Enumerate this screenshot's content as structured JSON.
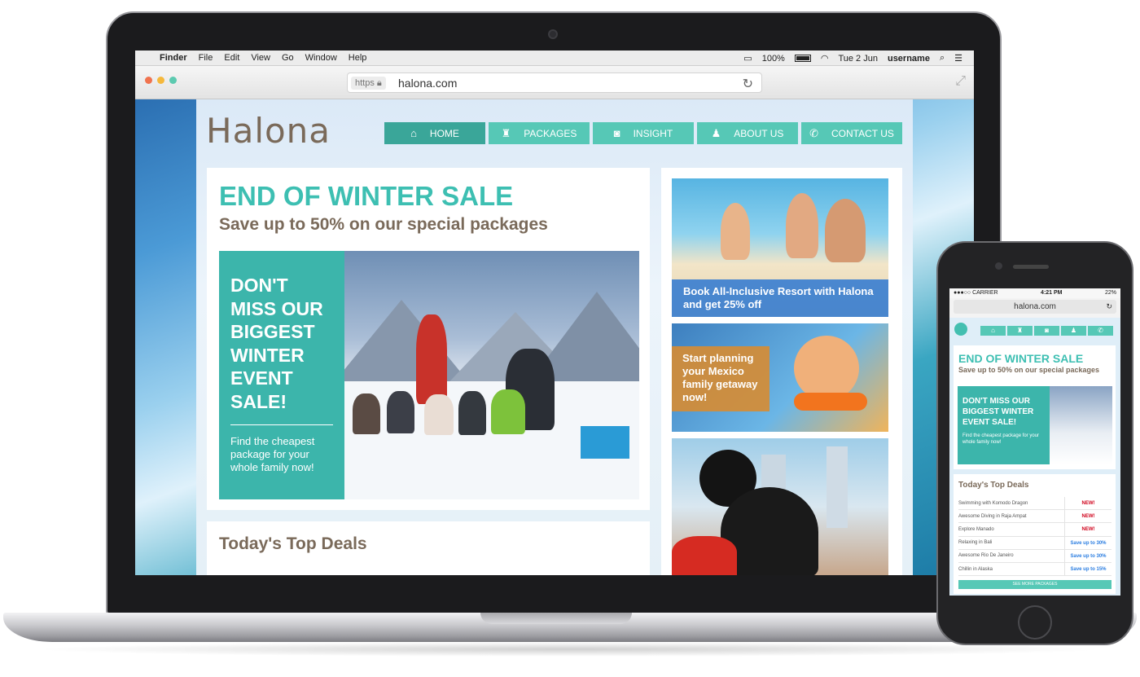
{
  "menubar": {
    "apple": "",
    "app": "Finder",
    "items": [
      "File",
      "Edit",
      "View",
      "Go",
      "Window",
      "Help"
    ],
    "battery": "100%",
    "date": "Tue 2 Jun",
    "user": "username"
  },
  "browser": {
    "protocol": "https",
    "url": "halona.com"
  },
  "site": {
    "logo": "Halona",
    "nav": [
      {
        "label": "HOME",
        "icon": "home-icon",
        "glyph": "⌂"
      },
      {
        "label": "PACKAGES",
        "icon": "luggage-icon",
        "glyph": "♜"
      },
      {
        "label": "INSIGHT",
        "icon": "camera-icon",
        "glyph": "◙"
      },
      {
        "label": "ABOUT US",
        "icon": "person-icon",
        "glyph": "♟"
      },
      {
        "label": "CONTACT US",
        "icon": "phone-icon",
        "glyph": "✆"
      }
    ],
    "hero": {
      "title": "END OF WINTER SALE",
      "subtitle": "Save up to 50% on our special packages",
      "promo_lines": [
        "DON'T",
        "MISS OUR",
        "BIGGEST",
        "WINTER",
        "EVENT",
        "SALE!"
      ],
      "promo_body": "Find the cheapest package for your whole family now!"
    },
    "deals_title": "Today's Top Deals",
    "tiles": {
      "resort": "Book All-Inclusive Resort with Halona and get 25% off",
      "mexico": "Start planning your Mexico family getaway now!"
    }
  },
  "phone": {
    "carrier": "●●●○○ CARRIER",
    "time": "4:21 PM",
    "battery": "22%",
    "url": "halona.com",
    "title": "END OF WINTER SALE",
    "subtitle": "Save up to 50% on our special packages",
    "promo_head": "DON'T MISS OUR BIGGEST WINTER EVENT SALE!",
    "promo_body": "Find the cheapest package for your whole family now!",
    "deals_title": "Today's Top Deals",
    "deals": [
      {
        "name": "Swimming with Komodo Dragon",
        "value": "NEW!",
        "color": "#d0021b"
      },
      {
        "name": "Awesome Diving in Raja Ampat",
        "value": "NEW!",
        "color": "#d0021b"
      },
      {
        "name": "Explore Manado",
        "value": "NEW!",
        "color": "#d0021b"
      },
      {
        "name": "Relaxing in Bali",
        "value": "Save up to 30%",
        "color": "#2a7de1"
      },
      {
        "name": "Awesome Rio De Janeiro",
        "value": "Save up to 30%",
        "color": "#2a7de1"
      },
      {
        "name": "Chillin in Alaska",
        "value": "Save up to 15%",
        "color": "#2a7de1"
      }
    ],
    "more_button": "SEE MORE PACKAGES"
  },
  "colors": {
    "accent": "#56c8b6",
    "accent_dark": "#3cb5ab",
    "title": "#3dbfb2",
    "brown": "#7a6a5a"
  }
}
